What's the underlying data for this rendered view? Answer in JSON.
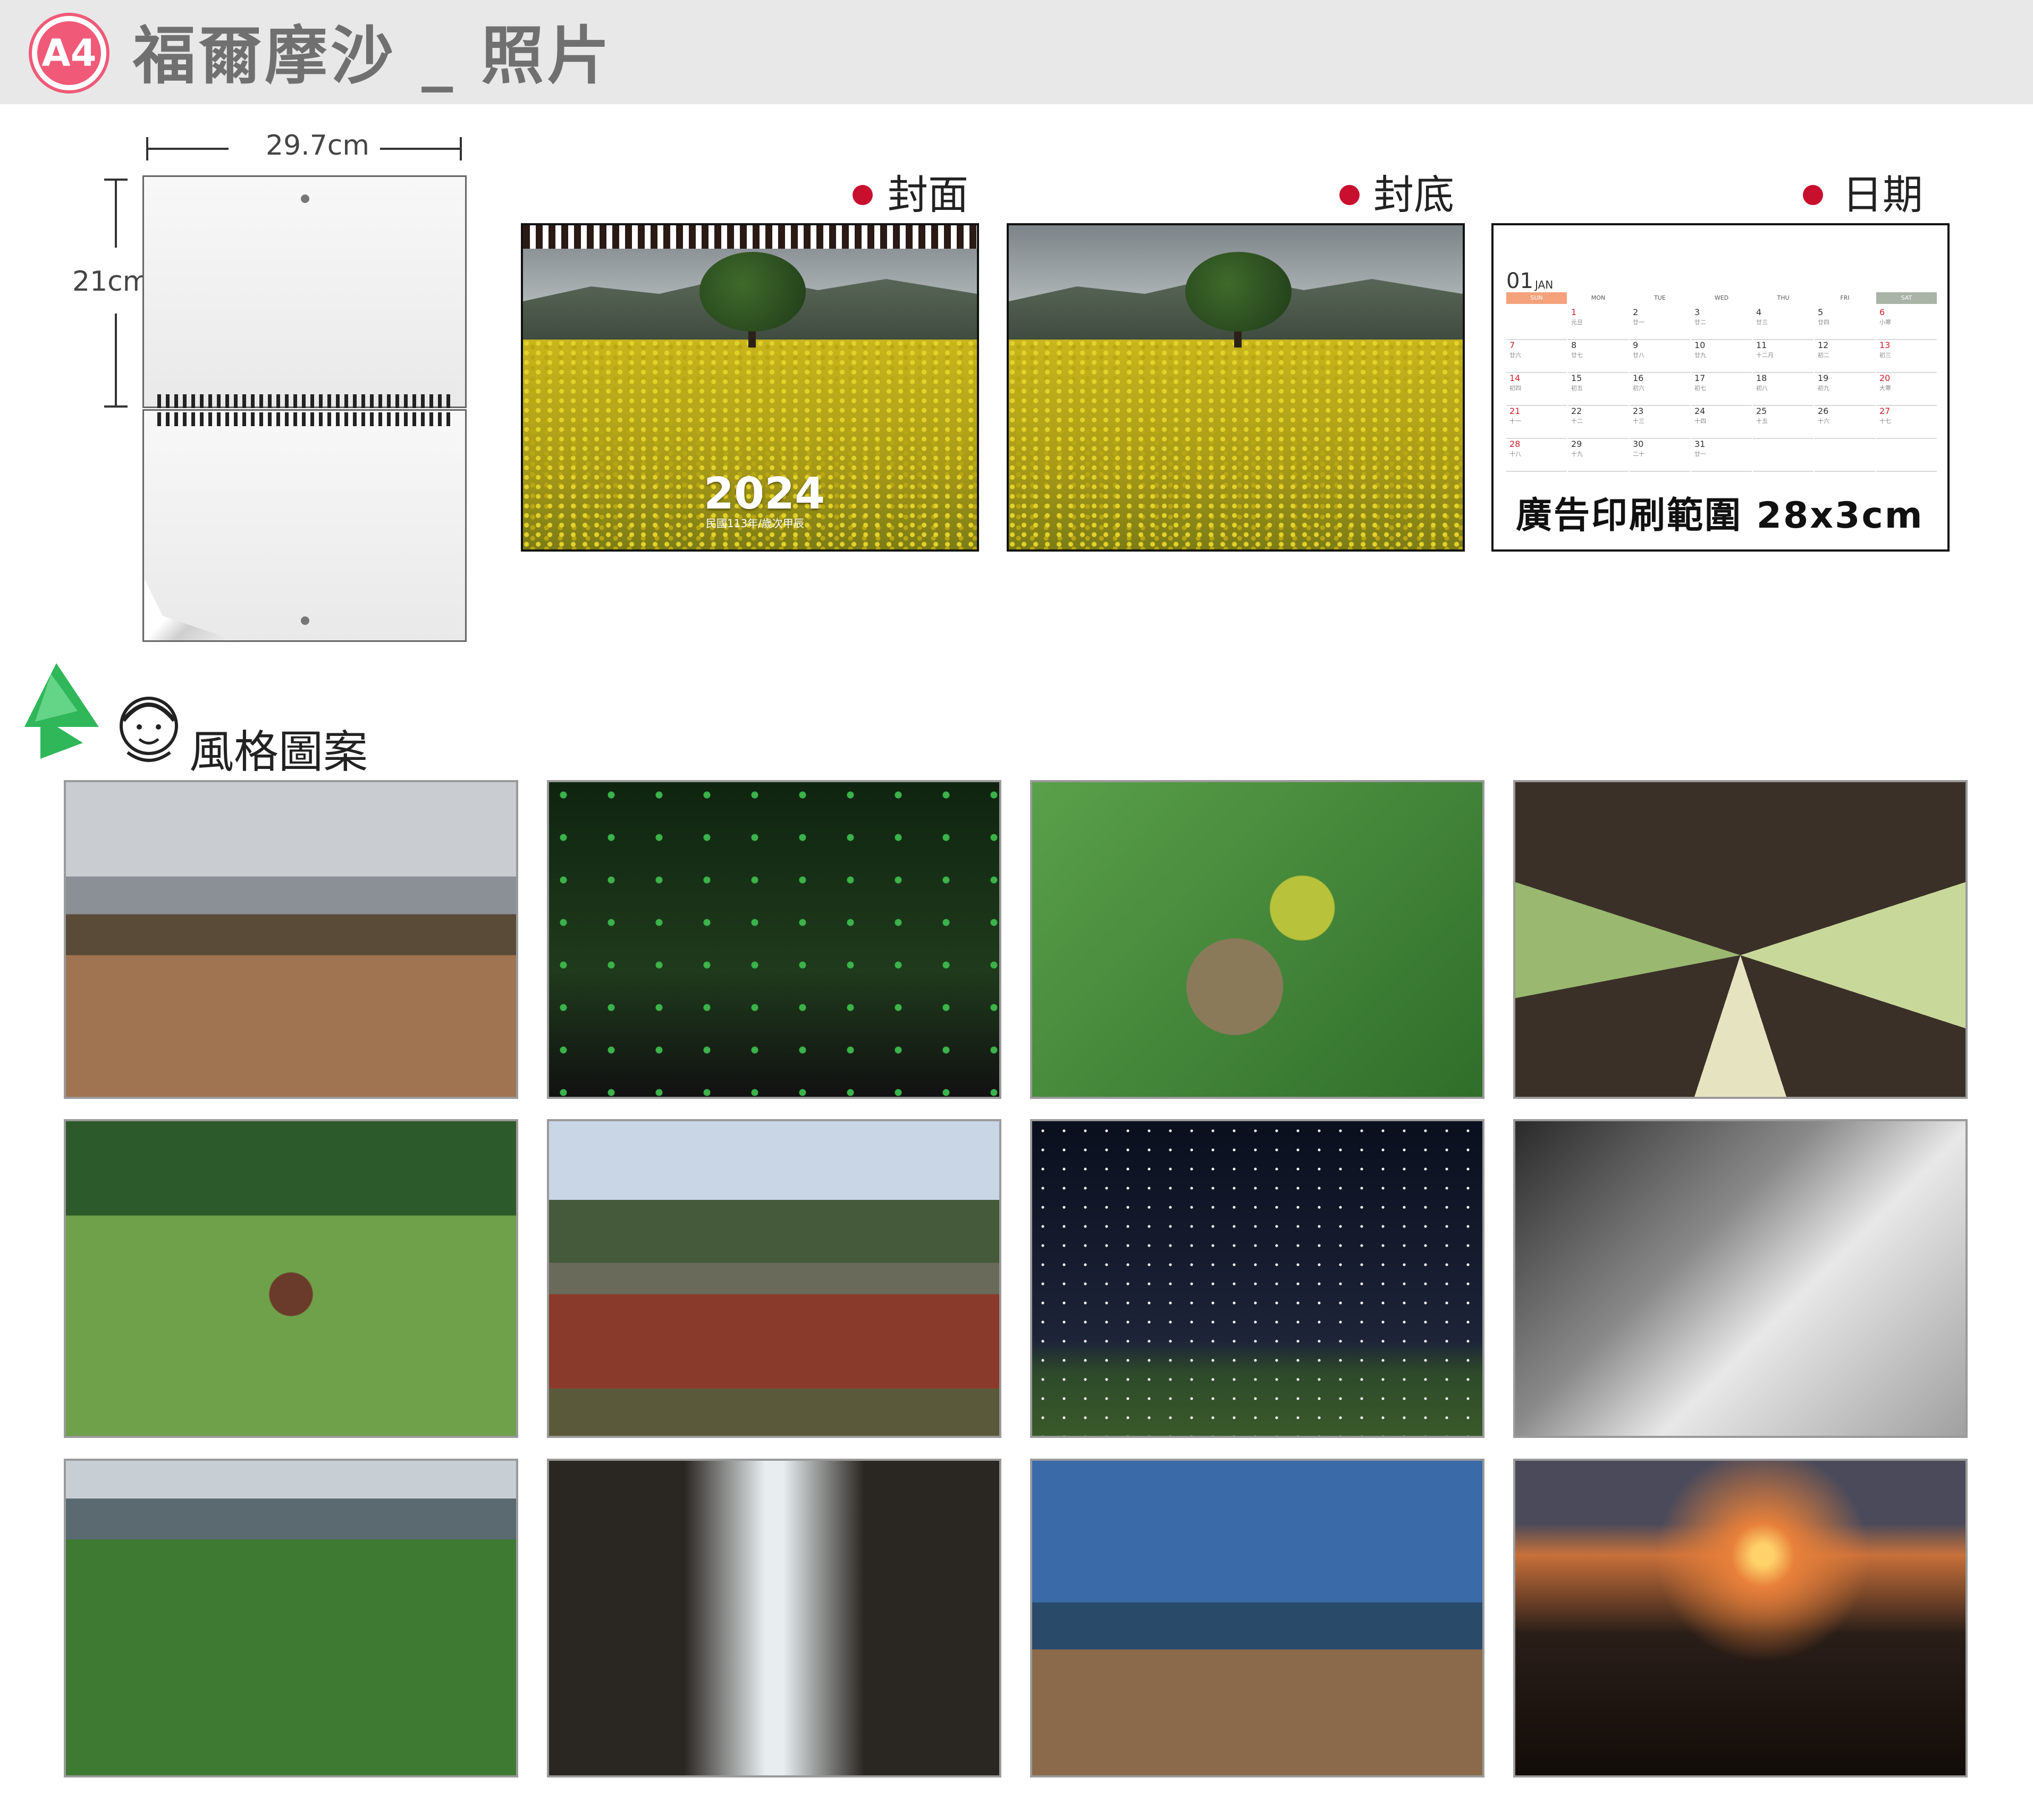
{
  "header": {
    "badge": "A4",
    "title": "福爾摩沙 _ 照片"
  },
  "dimensions": {
    "width_label": "29.7cm",
    "height_label": "21cm"
  },
  "sections": {
    "cover": "封面",
    "back": "封底",
    "date": "日期"
  },
  "cover": {
    "year": "2024",
    "subtitle": "民國113年/歲次甲辰"
  },
  "calendar": {
    "month_number": "01",
    "month_name": "JAN",
    "weekdays": [
      "SUN",
      "MON",
      "TUE",
      "WED",
      "THU",
      "FRI",
      "SAT"
    ],
    "rows": [
      [
        [
          "",
          ""
        ],
        [
          "1",
          "元旦"
        ],
        [
          "2",
          "廿一"
        ],
        [
          "3",
          "廿二"
        ],
        [
          "4",
          "廿三"
        ],
        [
          "5",
          "廿四"
        ],
        [
          "6",
          "小寒"
        ]
      ],
      [
        [
          "7",
          "廿六"
        ],
        [
          "8",
          "廿七"
        ],
        [
          "9",
          "廿八"
        ],
        [
          "10",
          "廿九"
        ],
        [
          "11",
          "十二月"
        ],
        [
          "12",
          "初二"
        ],
        [
          "13",
          "初三"
        ]
      ],
      [
        [
          "14",
          "初四"
        ],
        [
          "15",
          "初五"
        ],
        [
          "16",
          "初六"
        ],
        [
          "17",
          "初七"
        ],
        [
          "18",
          "初八"
        ],
        [
          "19",
          "初九"
        ],
        [
          "20",
          "大寒"
        ]
      ],
      [
        [
          "21",
          "十一"
        ],
        [
          "22",
          "十二"
        ],
        [
          "23",
          "十三"
        ],
        [
          "24",
          "十四"
        ],
        [
          "25",
          "十五"
        ],
        [
          "26",
          "十六"
        ],
        [
          "27",
          "十七"
        ]
      ],
      [
        [
          "28",
          "十八"
        ],
        [
          "29",
          "十九"
        ],
        [
          "30",
          "二十"
        ],
        [
          "31",
          "廿一"
        ],
        [
          "",
          ""
        ],
        [
          "",
          ""
        ],
        [
          "",
          ""
        ]
      ]
    ],
    "ad_text": "廣告印刷範圍 28x3cm",
    "colors": {
      "sun": "#f3a27c",
      "sat": "#a9b3a6",
      "holiday": "#d0202a"
    }
  },
  "style_section": {
    "label": "風格圖案"
  },
  "photos": [
    {
      "name": "rocky-coast-photo",
      "icon": "coast"
    },
    {
      "name": "firefly-forest-photo",
      "icon": "forest"
    },
    {
      "name": "birds-nest-photo",
      "icon": "bird"
    },
    {
      "name": "tree-canopy-photo",
      "icon": "trees"
    },
    {
      "name": "pheasant-grass-photo",
      "icon": "pheasant"
    },
    {
      "name": "red-algae-river-photo",
      "icon": "river"
    },
    {
      "name": "starry-camp-photo",
      "icon": "stars"
    },
    {
      "name": "snow-trail-photo",
      "icon": "snow"
    },
    {
      "name": "green-reef-photo",
      "icon": "reef"
    },
    {
      "name": "waterfall-gorge-photo",
      "icon": "waterfall"
    },
    {
      "name": "rock-pillar-sea-photo",
      "icon": "pillar"
    },
    {
      "name": "mountain-sunset-photo",
      "icon": "sunset"
    }
  ]
}
